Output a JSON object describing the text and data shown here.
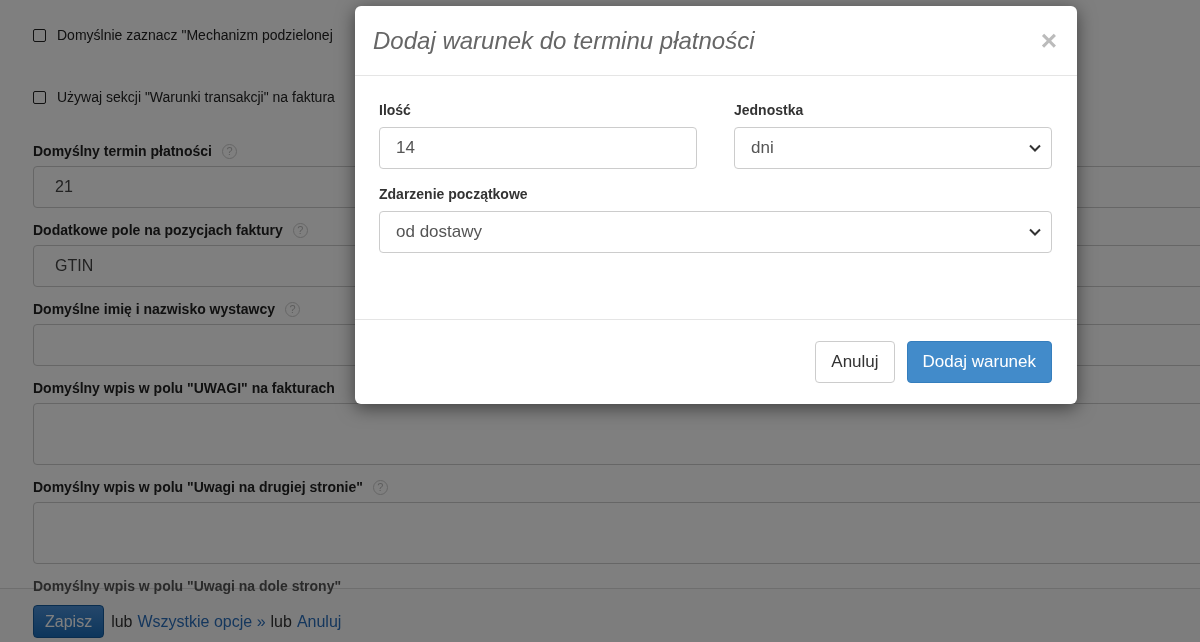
{
  "settings": {
    "checkboxes": [
      {
        "label": "Domyślnie zaznacz \"Mechanizm podzielonej",
        "checked": false
      },
      {
        "label": "Używaj sekcji \"Warunki transakcji\" na faktura",
        "checked": false
      }
    ],
    "fields": [
      {
        "label": "Domyślny termin płatności",
        "help": "?",
        "kind": "input",
        "value": "21"
      },
      {
        "label": "Dodatkowe pole na pozycjach faktury",
        "help": "?",
        "kind": "input",
        "value": "GTIN"
      },
      {
        "label": "Domyślne imię i nazwisko wystawcy",
        "help": "?",
        "kind": "input"
      },
      {
        "label": "Domyślny wpis w polu \"UWAGI\" na fakturach",
        "kind": "textarea"
      },
      {
        "label": "Domyślny wpis w polu \"Uwagi na drugiej stronie\"",
        "help": "?",
        "kind": "textarea"
      },
      {
        "label": "Domyślny wpis w polu \"Uwagi na dole strony\"",
        "kind": "label"
      }
    ]
  },
  "footer": [
    {
      "kind": "button",
      "text": "Zapisz"
    },
    {
      "kind": "text",
      "text": "lub"
    },
    {
      "kind": "link",
      "text": "Wszystkie opcje »"
    },
    {
      "kind": "text",
      "text": "lub"
    },
    {
      "kind": "link",
      "text": "Anuluj"
    }
  ],
  "dialog": {
    "title": "Dodaj warunek do terminu płatności",
    "close": "×",
    "rows": [
      [
        {
          "label": "Ilość",
          "kind": "input",
          "value": "14"
        },
        {
          "label": "Jednostka",
          "kind": "select",
          "value": "dni"
        }
      ],
      [
        {
          "label": "Zdarzenie początkowe",
          "kind": "select",
          "value": "od dostawy"
        }
      ]
    ],
    "buttons": [
      {
        "label": "Anuluj",
        "kind": "default"
      },
      {
        "label": "Dodaj warunek",
        "kind": "primary"
      }
    ]
  }
}
